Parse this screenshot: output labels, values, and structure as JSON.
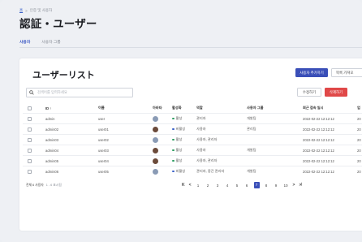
{
  "breadcrumb": {
    "home": "홈",
    "sep": ">",
    "current": "인증 및 사용자"
  },
  "page": {
    "title": "認証・ユーザー"
  },
  "tabs": [
    {
      "label": "사용자",
      "active": true
    },
    {
      "label": "사용자 그룹",
      "active": false
    }
  ],
  "card": {
    "title": "ユーザーリスト",
    "add_button": "사용자 추가하기",
    "export_button": "목록 가져오",
    "edit_button": "수정하기",
    "delete_button": "삭제하기",
    "search_placeholder": "검색어를 입력하세요"
  },
  "table": {
    "headers": {
      "id": "ID ↑",
      "name": "이름",
      "avatar": "아바타",
      "active": "활성화",
      "role": "역할",
      "group": "사용자 그룹",
      "login": "최근 접속 일시",
      "extra": "업"
    },
    "rows": [
      {
        "id": "admin",
        "name": "user",
        "avatar_color": "#8a9bb5",
        "status": "활성",
        "status_color": "#2f9e63",
        "role": "관리자",
        "group": "개발팀",
        "login": "2022-02-22 12:12:12",
        "extra": "20"
      },
      {
        "id": "admin02",
        "name": "user01",
        "avatar_color": "#6b4a3a",
        "status": "비활성",
        "status_color": "#3b62c9",
        "role": "사용자",
        "group": "관리팀",
        "login": "2022-02-22 12:12:12",
        "extra": "20"
      },
      {
        "id": "admin03",
        "name": "user02",
        "avatar_color": "#8a9bb5",
        "status": "활성",
        "status_color": "#2f9e63",
        "role": "사용자, 관리자",
        "group": "",
        "login": "2022-02-22 12:12:12",
        "extra": "20"
      },
      {
        "id": "admin04",
        "name": "user03",
        "avatar_color": "#6b4a3a",
        "status": "활성",
        "status_color": "#2f9e63",
        "role": "사용자",
        "group": "개발팀",
        "login": "2022-02-22 12:12:12",
        "extra": "20"
      },
      {
        "id": "admin05",
        "name": "user04",
        "avatar_color": "#6b4a3a",
        "status": "활성",
        "status_color": "#2f9e63",
        "role": "사용자, 관리자",
        "group": "",
        "login": "2022-02-22 12:12:12",
        "extra": "20"
      },
      {
        "id": "admin06",
        "name": "user05",
        "avatar_color": "#8a9bb5",
        "status": "비활성",
        "status_color": "#3b62c9",
        "role": "관리자, 중간 관리자",
        "group": "개발팀",
        "login": "2022-02-22 12:12:12",
        "extra": "20"
      }
    ]
  },
  "footer": {
    "count": "전체 6 사용자",
    "sub": "1 - 6 표시됨"
  },
  "pagination": {
    "first": "K",
    "prev": "<",
    "next": ">",
    "last": "≯",
    "pages": [
      "1",
      "2",
      "3",
      "4",
      "5",
      "6",
      "7",
      "8",
      "9",
      "10"
    ],
    "active_page": "7"
  }
}
